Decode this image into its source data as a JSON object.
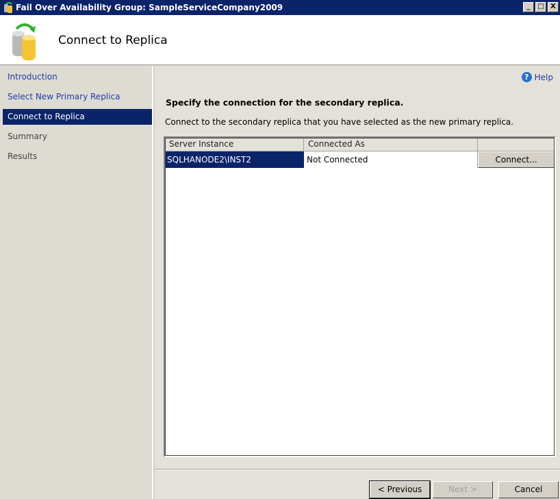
{
  "window": {
    "title": "Fail Over Availability Group: SampleServiceCompany2009",
    "minimize": "_",
    "maximize": "□",
    "close": "X"
  },
  "header": {
    "title": "Connect to Replica"
  },
  "sidebar": {
    "items": [
      {
        "label": "Introduction"
      },
      {
        "label": "Select New Primary Replica"
      },
      {
        "label": "Connect to Replica"
      },
      {
        "label": "Summary"
      },
      {
        "label": "Results"
      }
    ]
  },
  "main": {
    "help": "Help",
    "heading": "Specify the connection for the secondary replica.",
    "description": "Connect to the secondary replica that you have selected as the new primary replica.",
    "grid": {
      "columns": [
        "Server Instance",
        "Connected As",
        ""
      ],
      "rows": [
        {
          "server": "SQLHANODE2\\INST2",
          "connected_as": "Not Connected",
          "action": "Connect..."
        }
      ]
    }
  },
  "footer": {
    "previous": "< Previous",
    "next": "Next >",
    "cancel": "Cancel"
  }
}
